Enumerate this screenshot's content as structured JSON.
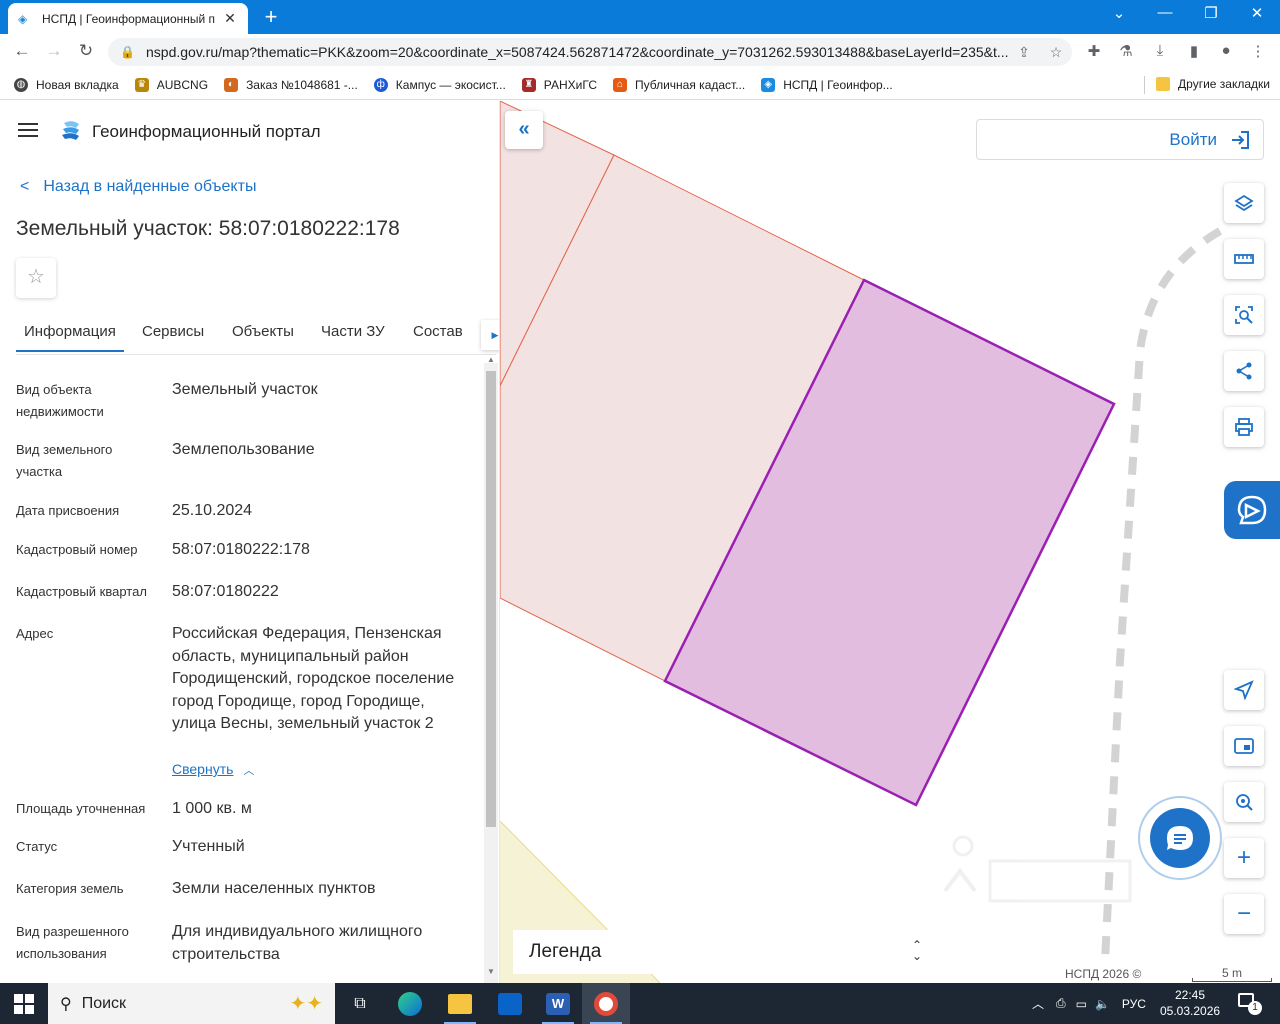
{
  "browser": {
    "tab_title": "НСПД | Геоинформационный п",
    "url": "nspd.gov.ru/map?thematic=PKK&zoom=20&coordinate_x=5087424.562871472&coordinate_y=7031262.593013488&baseLayerId=235&t...",
    "bookmarks": [
      {
        "label": "Новая вкладка",
        "color": "#444"
      },
      {
        "label": "AUBCNG",
        "color": "#b8860b"
      },
      {
        "label": "Заказ №1048681 -...",
        "color": "#333"
      },
      {
        "label": "Кампус — экосист...",
        "color": "#1e5ad6"
      },
      {
        "label": "РАНХиГС",
        "color": "#a52a2a"
      },
      {
        "label": "Публичная кадаст...",
        "color": "#e55b13"
      },
      {
        "label": "НСПД | Геоинфор...",
        "color": "#1a8be0"
      }
    ],
    "other_bookmarks": "Другие закладки"
  },
  "sidebar": {
    "portal_title": "Геоинформационный портал",
    "back_label": "Назад в найденные объекты",
    "page_title": "Земельный участок: 58:07:0180222:178",
    "tabs": [
      "Информация",
      "Сервисы",
      "Объекты",
      "Части ЗУ",
      "Состав"
    ],
    "props": [
      {
        "label": "Вид объекта недвижимости",
        "value": "Земельный участок"
      },
      {
        "label": "Вид земельного участка",
        "value": "Землепользование"
      },
      {
        "label": "Дата присвоения",
        "value": "25.10.2024"
      },
      {
        "label": "Кадастровый номер",
        "value": "58:07:0180222:178"
      },
      {
        "label": "Кадастровый квартал",
        "value": "58:07:0180222"
      },
      {
        "label": "Адрес",
        "value": "Российская Федерация, Пензенская область, муниципальный район Городищенский, городское поселение город Городище, город Городище, улица Весны, земельный участок 2"
      },
      {
        "label": "Площадь уточненная",
        "value": "1 000 кв. м"
      },
      {
        "label": "Статус",
        "value": "Учтенный"
      },
      {
        "label": "Категория земель",
        "value": "Земли населенных пунктов"
      },
      {
        "label": "Вид разрешенного использования",
        "value": "Для индивидуального жилищного строительства"
      }
    ],
    "collapse_label": "Свернуть"
  },
  "map": {
    "login_label": "Войти",
    "legend_label": "Легенда",
    "attribution": "НСПД 2026 ©",
    "scale_label": "5 m",
    "colors": {
      "accent": "#1e73c8",
      "selected_parcel": "#9a1fb3",
      "neighbor_parcel": "#e3644a"
    }
  },
  "taskbar": {
    "search_placeholder": "Поиск",
    "lang": "РУС",
    "time": "22:45",
    "date": "05.03.2026",
    "notif_count": "1"
  }
}
